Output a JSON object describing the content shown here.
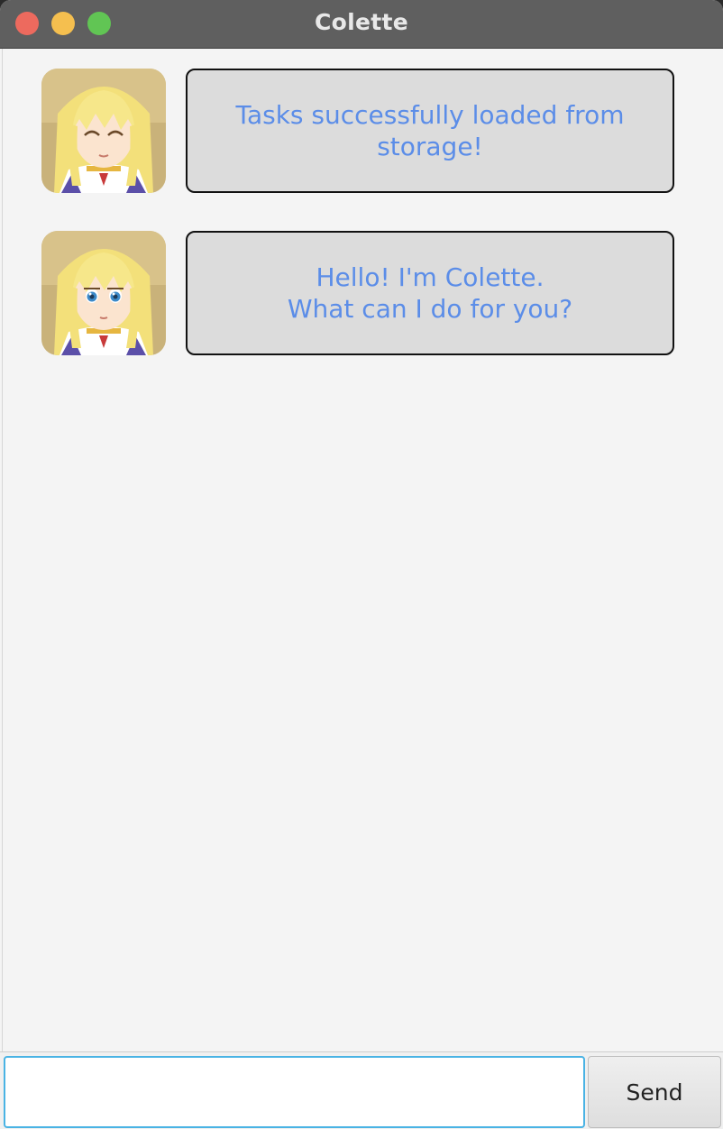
{
  "window": {
    "title": "Colette"
  },
  "chat": {
    "messages": [
      {
        "sender": "Colette",
        "avatar": "colette-smiling-avatar",
        "text": "Tasks successfully loaded from\nstorage!"
      },
      {
        "sender": "Colette",
        "avatar": "colette-avatar",
        "text": "Hello! I'm Colette.\nWhat can I do for you?"
      }
    ]
  },
  "input": {
    "value": "",
    "send_label": "Send"
  },
  "colors": {
    "bubble_text": "#5b8de8",
    "bubble_bg": "#dcdcdc",
    "input_focus": "#4ab3e4",
    "titlebar": "#5f5f5f"
  }
}
